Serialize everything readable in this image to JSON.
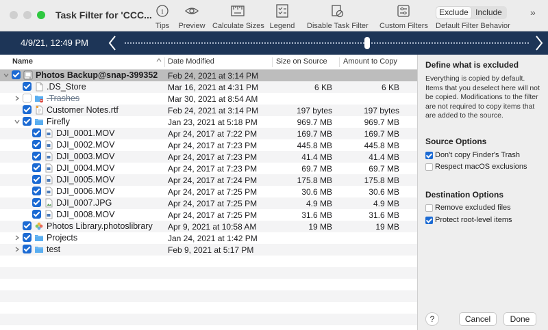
{
  "window": {
    "title": "Task Filter for 'CCC..."
  },
  "toolbar": {
    "tips": "Tips",
    "preview": "Preview",
    "calculate_sizes": "Calculate Sizes",
    "legend": "Legend",
    "disable_task_filter": "Disable Task Filter",
    "custom_filters": "Custom Filters",
    "segment": {
      "exclude": "Exclude",
      "include": "Include",
      "selected": "Exclude"
    },
    "default_filter_behavior": "Default Filter Behavior",
    "overflow": "»"
  },
  "timeline": {
    "date": "4/9/21, 12:49 PM",
    "position_fraction": 0.6
  },
  "table": {
    "columns": {
      "name": "Name",
      "date_modified": "Date Modified",
      "size_on_source": "Size on Source",
      "amount_to_copy": "Amount to Copy"
    },
    "rows": [
      {
        "name": "Photos Backup@snap-399352",
        "date": "Feb 24, 2021 at 3:14 PM",
        "size": "",
        "amount": "",
        "level": 0,
        "checked": true,
        "expanded": true,
        "icon": "drive-icon",
        "bold": true,
        "selected": true
      },
      {
        "name": ".DS_Store",
        "date": "Mar 16, 2021 at 4:31 PM",
        "size": "6 KB",
        "amount": "6 KB",
        "level": 1,
        "checked": true,
        "icon": "document-icon"
      },
      {
        "name": ".Trashes",
        "date": "Mar 30, 2021 at 8:54 AM",
        "size": "",
        "amount": "",
        "level": 1,
        "checked": false,
        "collapsed": true,
        "icon": "folder-excluded-icon",
        "strike": true
      },
      {
        "name": "Customer Notes.rtf",
        "date": "Feb 24, 2021 at 3:14 PM",
        "size": "197 bytes",
        "amount": "197 bytes",
        "level": 1,
        "checked": true,
        "icon": "rtf-file-icon"
      },
      {
        "name": "Firefly",
        "date": "Jan 23, 2021 at 5:18 PM",
        "size": "969.7 MB",
        "amount": "969.7 MB",
        "level": 1,
        "checked": true,
        "expanded": true,
        "icon": "folder-icon"
      },
      {
        "name": "DJI_0001.MOV",
        "date": "Apr 24, 2017 at 7:22 PM",
        "size": "169.7 MB",
        "amount": "169.7 MB",
        "level": 2,
        "checked": true,
        "icon": "movie-file-icon"
      },
      {
        "name": "DJI_0002.MOV",
        "date": "Apr 24, 2017 at 7:23 PM",
        "size": "445.8 MB",
        "amount": "445.8 MB",
        "level": 2,
        "checked": true,
        "icon": "movie-file-icon"
      },
      {
        "name": "DJI_0003.MOV",
        "date": "Apr 24, 2017 at 7:23 PM",
        "size": "41.4 MB",
        "amount": "41.4 MB",
        "level": 2,
        "checked": true,
        "icon": "movie-file-icon"
      },
      {
        "name": "DJI_0004.MOV",
        "date": "Apr 24, 2017 at 7:23 PM",
        "size": "69.7 MB",
        "amount": "69.7 MB",
        "level": 2,
        "checked": true,
        "icon": "movie-file-icon"
      },
      {
        "name": "DJI_0005.MOV",
        "date": "Apr 24, 2017 at 7:24 PM",
        "size": "175.8 MB",
        "amount": "175.8 MB",
        "level": 2,
        "checked": true,
        "icon": "movie-file-icon"
      },
      {
        "name": "DJI_0006.MOV",
        "date": "Apr 24, 2017 at 7:25 PM",
        "size": "30.6 MB",
        "amount": "30.6 MB",
        "level": 2,
        "checked": true,
        "icon": "movie-file-icon"
      },
      {
        "name": "DJI_0007.JPG",
        "date": "Apr 24, 2017 at 7:25 PM",
        "size": "4.9 MB",
        "amount": "4.9 MB",
        "level": 2,
        "checked": true,
        "icon": "image-file-icon"
      },
      {
        "name": "DJI_0008.MOV",
        "date": "Apr 24, 2017 at 7:25 PM",
        "size": "31.6 MB",
        "amount": "31.6 MB",
        "level": 2,
        "checked": true,
        "icon": "movie-file-icon"
      },
      {
        "name": "Photos Library.photoslibrary",
        "date": "Apr 9, 2021 at 10:58 AM",
        "size": "19 MB",
        "amount": "19 MB",
        "level": 1,
        "checked": true,
        "icon": "photos-library-icon"
      },
      {
        "name": "Projects",
        "date": "Jan 24, 2021 at 1:42 PM",
        "size": "",
        "amount": "",
        "level": 1,
        "checked": true,
        "collapsed": true,
        "icon": "folder-icon"
      },
      {
        "name": "test",
        "date": "Feb 9, 2021 at 5:17 PM",
        "size": "",
        "amount": "",
        "level": 1,
        "checked": true,
        "collapsed": true,
        "icon": "folder-icon"
      }
    ]
  },
  "panel": {
    "heading": "Define what is excluded",
    "description": "Everything is copied by default. Items that you deselect here will not be copied. Modifications to the filter are not required to copy items that are added to the source.",
    "source_options": {
      "heading": "Source Options",
      "dont_copy_trash": {
        "label": "Don't copy Finder's Trash",
        "checked": true
      },
      "respect_exclusions": {
        "label": "Respect macOS exclusions",
        "checked": false
      }
    },
    "destination_options": {
      "heading": "Destination Options",
      "remove_excluded": {
        "label": "Remove excluded files",
        "checked": false
      },
      "protect_root": {
        "label": "Protect root-level items",
        "checked": true
      }
    },
    "help": "?",
    "cancel": "Cancel",
    "done": "Done"
  },
  "colors": {
    "accent": "#1b6ad3",
    "timeline_bg": "#1d3557",
    "folder": "#5aaef0"
  }
}
